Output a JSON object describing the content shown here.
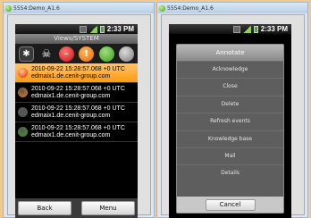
{
  "left": {
    "window_title": "5554:Demo_A1.6",
    "clock": "2:33 PM",
    "app_title": "Views/SYSTEM",
    "toolbar_icons": [
      {
        "name": "all-filter-icon",
        "glyph": "✱"
      },
      {
        "name": "skull-filter-icon",
        "glyph": "☠"
      },
      {
        "name": "critical-filter-icon",
        "glyph": "–"
      },
      {
        "name": "warning-filter-icon",
        "glyph": "!"
      },
      {
        "name": "ok-filter-icon",
        "glyph": "•"
      },
      {
        "name": "unknown-filter-icon",
        "glyph": "•"
      }
    ],
    "events": [
      {
        "line1": "2010-09-22 15:28:57.068 +0 UTC",
        "line2": "edmaix1.de.cenit-group.com",
        "icon_color": "#e02020",
        "selected": true
      },
      {
        "line1": "2010-09-22 15:28:57.068 +0 UTC",
        "line2": "edmaix1.de.cenit-group.com",
        "icon_color": "#f07a10",
        "selected": false
      },
      {
        "line1": "2010-09-22 15:28:57.068 +0 UTC",
        "line2": "edmaix1.de.cenit-group.com",
        "icon_color": "#555555",
        "selected": false
      },
      {
        "line1": "2010-09-22 15:28:57.068 +0 UTC",
        "line2": "edmaix1.de.cenit-group.com",
        "icon_color": "#40a020",
        "selected": false
      }
    ],
    "back_label": "Back",
    "menu_label": "Menu"
  },
  "right": {
    "window_title": "5554:Demo_A1.6",
    "clock": "2:33 PM",
    "menu": {
      "header": "Annotate",
      "items": [
        "Acknowledge",
        "Close",
        "Delete",
        "Refresh events",
        "Knowledge base",
        "Mail",
        "Details"
      ],
      "cancel_label": "Cancel"
    }
  }
}
